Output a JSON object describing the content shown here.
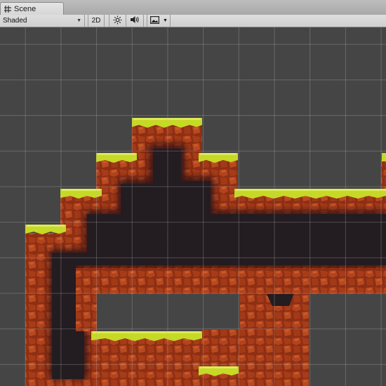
{
  "window": {
    "tab_label": "Scene",
    "tab_icon": "grid-icon"
  },
  "toolbar": {
    "draw_mode": "Shaded",
    "mode_2d_label": "2D",
    "lighting_icon": "sun-icon",
    "audio_icon": "speaker-icon",
    "effects_icon": "image-icon"
  },
  "scene": {
    "grid": "on",
    "colors": {
      "background": "#454545",
      "grass": "#c6d927",
      "rock": "#a33a18",
      "cave": "#231c20"
    }
  }
}
